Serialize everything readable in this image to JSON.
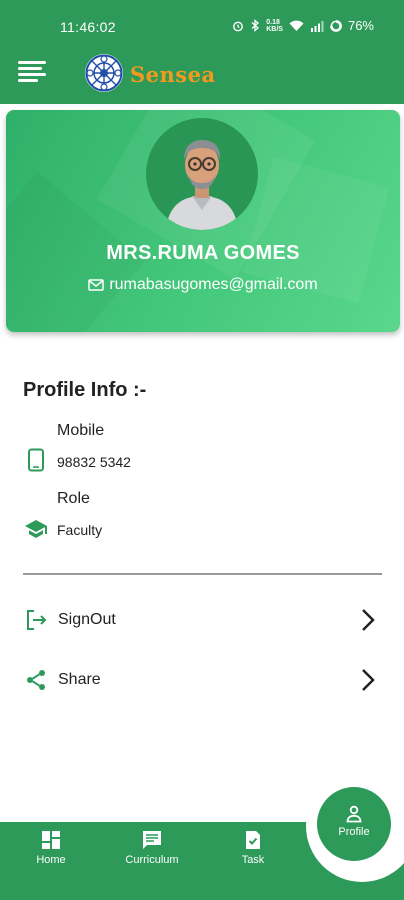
{
  "status_bar": {
    "time": "11:46:02",
    "network": "0.18\nKB/S",
    "battery": "76%"
  },
  "app": {
    "brand": "Sensea",
    "accent": "#2e9a5a",
    "brand_color": "#f39a1d"
  },
  "profile": {
    "name": "MRS.RUMA GOMES",
    "email": "rumabasugomes@gmail.com"
  },
  "info": {
    "title": "Profile Info :-",
    "mobile_label": "Mobile",
    "mobile_value": "98832 5342",
    "role_label": "Role",
    "role_value": "Faculty"
  },
  "actions": {
    "signout": "SignOut",
    "share": "Share"
  },
  "nav": {
    "home": "Home",
    "curriculum": "Curriculum",
    "task": "Task",
    "profile": "Profile"
  }
}
